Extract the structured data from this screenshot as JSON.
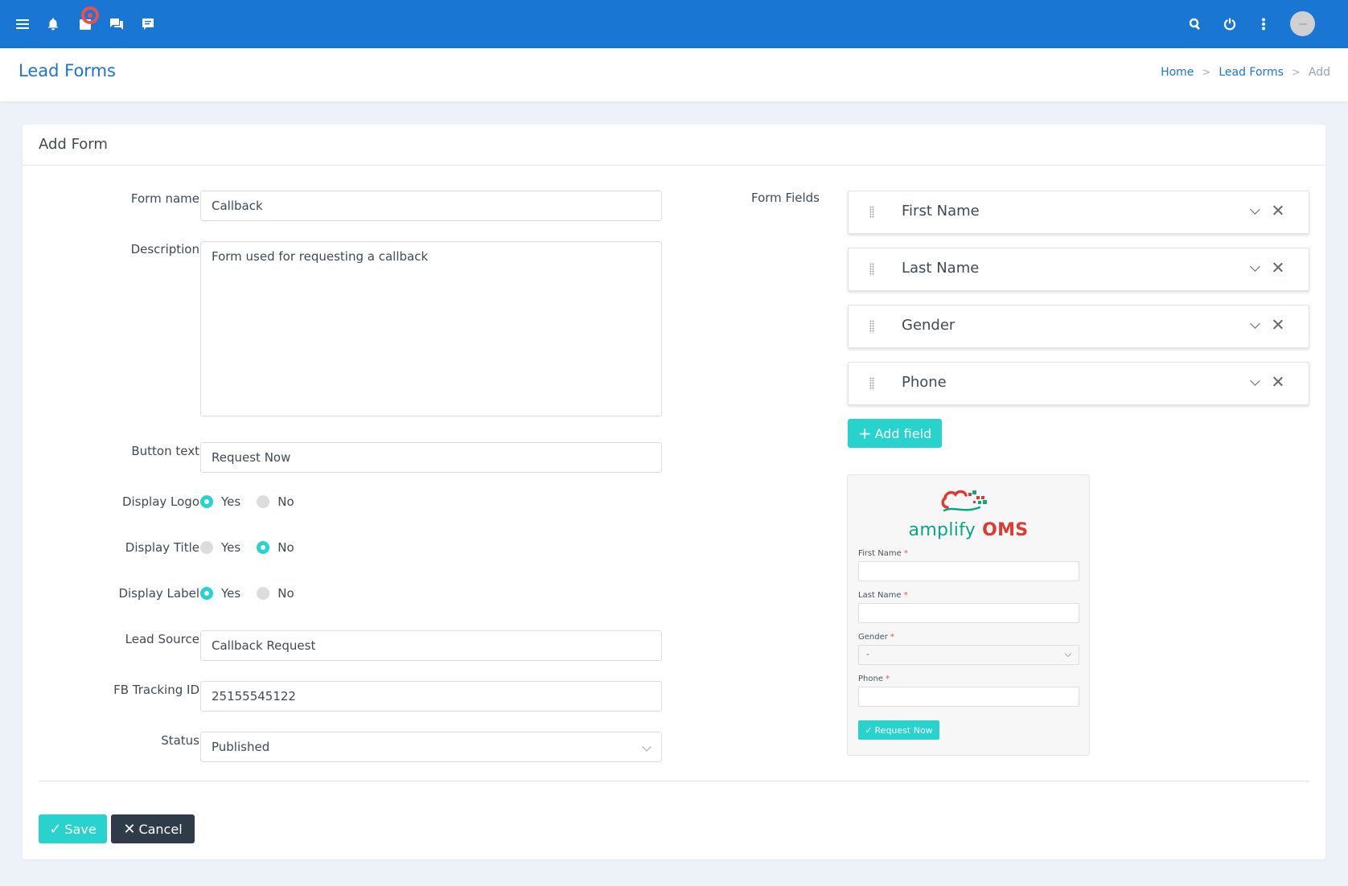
{
  "topbar": {
    "left_icons": [
      "menu-icon",
      "bell-icon",
      "inbox-icon",
      "chat-icon",
      "message-icon"
    ],
    "right_icons": [
      "search-icon",
      "power-icon",
      "more-vertical-icon"
    ],
    "colors": {
      "bar": "#1976d2",
      "notification": "#e9514f"
    }
  },
  "header": {
    "title": "Lead Forms",
    "breadcrumb": [
      {
        "label": "Home",
        "link": true
      },
      {
        "label": "Lead Forms",
        "link": true
      },
      {
        "label": "Add",
        "link": false
      }
    ],
    "separator": ">"
  },
  "card": {
    "title": "Add Form"
  },
  "form": {
    "form_name": {
      "label": "Form name",
      "value": "Callback"
    },
    "description": {
      "label": "Description",
      "value": "Form used for requesting a callback"
    },
    "button_text": {
      "label": "Button text",
      "value": "Request Now"
    },
    "display_logo": {
      "label": "Display Logo",
      "options": [
        "Yes",
        "No"
      ],
      "selected": "Yes"
    },
    "display_title": {
      "label": "Display Title",
      "options": [
        "Yes",
        "No"
      ],
      "selected": "No"
    },
    "display_label": {
      "label": "Display Label",
      "options": [
        "Yes",
        "No"
      ],
      "selected": "Yes"
    },
    "lead_source": {
      "label": "Lead Source",
      "value": "Callback Request"
    },
    "fb_tracking_id": {
      "label": "FB Tracking ID",
      "value": "25155545122"
    },
    "status": {
      "label": "Status",
      "value": "Published"
    }
  },
  "form_fields": {
    "label": "Form Fields",
    "items": [
      {
        "name": "First Name"
      },
      {
        "name": "Last Name"
      },
      {
        "name": "Gender"
      },
      {
        "name": "Phone"
      }
    ],
    "add_label": "Add field"
  },
  "preview": {
    "logo_word1": "amplify",
    "logo_word2": "OMS",
    "fields": [
      {
        "label": "First Name",
        "required": "*",
        "type": "text"
      },
      {
        "label": "Last Name",
        "required": "*",
        "type": "text"
      },
      {
        "label": "Gender",
        "required": "*",
        "type": "select",
        "value": "-"
      },
      {
        "label": "Phone",
        "required": "*",
        "type": "text"
      }
    ],
    "button_label": "Request Now"
  },
  "actions": {
    "save_label": "Save",
    "cancel_label": "Cancel"
  },
  "colors": {
    "accent": "#27d3cc",
    "primary": "#1976d2",
    "dark_button": "#2f3b49",
    "logo_green": "#0aa783",
    "logo_red": "#dd3b32"
  }
}
